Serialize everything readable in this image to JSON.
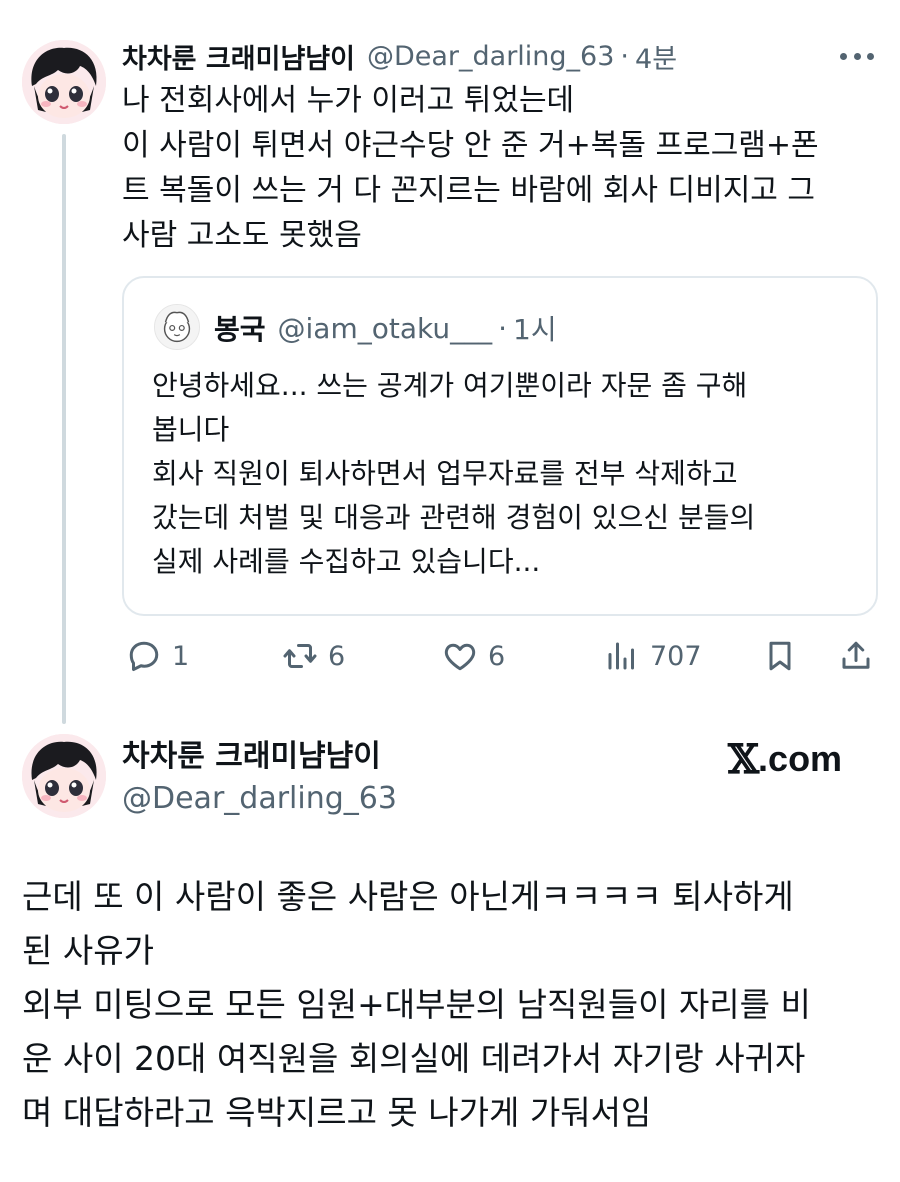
{
  "tweet1": {
    "author_name": "차차룬 크래미냠냠이",
    "author_handle": "@Dear_darling_63",
    "separator": "·",
    "time": "4분",
    "more_icon": "more-horizontal-icon",
    "body_lines": [
      "나 전회사에서 누가 이러고 튀었는데",
      "이 사람이 튀면서 야근수당 안 준 거+복돌 프로그램+폰",
      "트 복돌이 쓰는 거 다 꼰지르는 바람에 회사 디비지고 그",
      "사람 고소도 못했음"
    ],
    "quote": {
      "author_name": "봉국",
      "author_handle": "@iam_otaku___",
      "separator": "·",
      "time": "1시",
      "body_lines": [
        "안녕하세요... 쓰는 공계가 여기뿐이라 자문 좀 구해",
        "봅니다",
        "회사 직원이 퇴사하면서 업무자료를 전부 삭제하고",
        "갔는데 처벌 및 대응과 관련해 경험이 있으신 분들의",
        "실제 사례를 수집하고 있습니다..."
      ]
    },
    "actions": {
      "reply": {
        "icon": "reply-icon",
        "count": "1"
      },
      "retweet": {
        "icon": "retweet-icon",
        "count": "6"
      },
      "like": {
        "icon": "heart-icon",
        "count": "6"
      },
      "views": {
        "icon": "views-icon",
        "count": "707"
      },
      "bookmark": {
        "icon": "bookmark-icon"
      },
      "share": {
        "icon": "share-icon"
      }
    }
  },
  "tweet2": {
    "author_name": "차차룬 크래미냠냠이",
    "author_handle": "@Dear_darling_63",
    "brand_mark": "𝕏",
    "brand_suffix": ".com",
    "body_lines": [
      "근데 또 이 사람이 좋은 사람은 아닌게ㅋㅋㅋㅋ 퇴사하게",
      "된 사유가",
      "외부 미팅으로 모든 임원+대부분의 남직원들이 자리를 비",
      "운 사이 20대 여직원을 회의실에 데려가서 자기랑 사귀자",
      "며 대답하라고 윽박지르고 못 나가게 가둬서임"
    ]
  },
  "colors": {
    "text": "#0f1419",
    "secondary": "#536471",
    "border": "#e1e8ed",
    "thread_line": "#cfd9de"
  }
}
